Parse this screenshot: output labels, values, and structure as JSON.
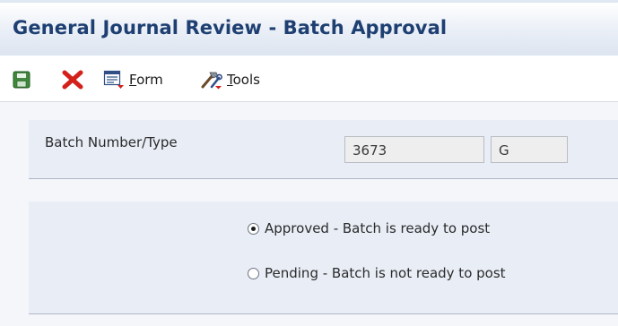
{
  "window": {
    "title": "General Journal Review - Batch Approval"
  },
  "toolbar": {
    "save_icon": "save-icon",
    "cancel_icon": "close-icon",
    "form_label_first": "F",
    "form_label_rest": "orm",
    "tools_label_first": "T",
    "tools_label_rest": "ools",
    "colors": {
      "save": "#3d8a3a",
      "cancel": "#d4201b"
    }
  },
  "batch": {
    "label": "Batch Number/Type",
    "number": "3673",
    "type": "G"
  },
  "approval": {
    "selected": "approved",
    "options": [
      {
        "id": "approved",
        "label": "Approved - Batch is ready to post"
      },
      {
        "id": "pending",
        "label": "Pending - Batch is not ready to post"
      }
    ]
  },
  "theme": {
    "title_color": "#1e3f72",
    "panel_bg": "#e8edf6"
  }
}
